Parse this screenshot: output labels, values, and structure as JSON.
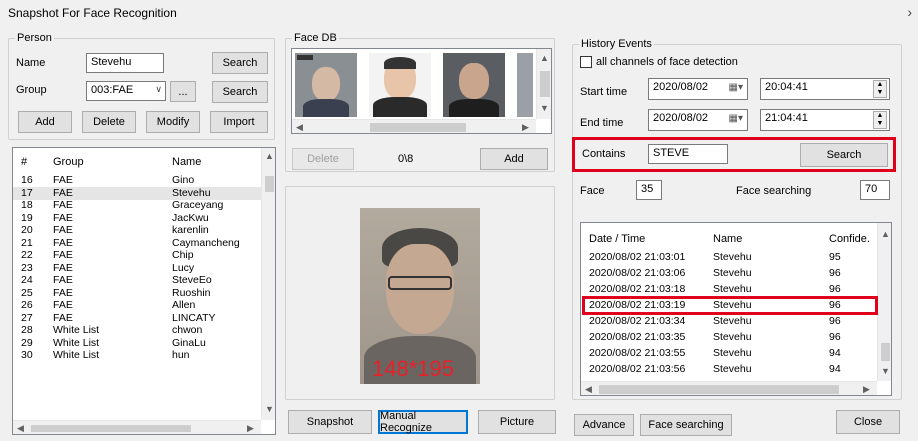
{
  "window": {
    "title": "Snapshot For Face Recognition",
    "close_glyph": "›"
  },
  "person": {
    "group_label": "Person",
    "name_label": "Name",
    "name_value": "Stevehu",
    "search_label": "Search",
    "group_field_label": "Group",
    "group_value": "003:FAE",
    "ellipsis_label": "...",
    "group_search_label": "Search",
    "add_label": "Add",
    "delete_label": "Delete",
    "modify_label": "Modify",
    "import_label": "Import",
    "list_headers": [
      "#",
      "Group",
      "Name"
    ],
    "rows": [
      {
        "num": "16",
        "group": "FAE",
        "name": "Gino"
      },
      {
        "num": "17",
        "group": "FAE",
        "name": "Stevehu"
      },
      {
        "num": "18",
        "group": "FAE",
        "name": "Graceyang"
      },
      {
        "num": "19",
        "group": "FAE",
        "name": "JacKwu"
      },
      {
        "num": "20",
        "group": "FAE",
        "name": "karenlin"
      },
      {
        "num": "21",
        "group": "FAE",
        "name": "Caymancheng"
      },
      {
        "num": "22",
        "group": "FAE",
        "name": "Chip"
      },
      {
        "num": "23",
        "group": "FAE",
        "name": "Lucy"
      },
      {
        "num": "24",
        "group": "FAE",
        "name": "SteveEo"
      },
      {
        "num": "25",
        "group": "FAE",
        "name": "Ruoshin"
      },
      {
        "num": "26",
        "group": "FAE",
        "name": "Allen"
      },
      {
        "num": "27",
        "group": "FAE",
        "name": "LINCATY"
      },
      {
        "num": "28",
        "group": "White List",
        "name": "chwon"
      },
      {
        "num": "29",
        "group": "White List",
        "name": "GinaLu"
      },
      {
        "num": "30",
        "group": "White List",
        "name": "hun"
      }
    ]
  },
  "facedb": {
    "group_label": "Face DB",
    "delete_label": "Delete",
    "counter": "0\\8",
    "add_label": "Add",
    "preview_size": "148*195"
  },
  "bottom": {
    "snapshot_label": "Snapshot",
    "manual_label": "Manual Recognize",
    "picture_label": "Picture",
    "advance_label": "Advance",
    "face_searching_label": "Face searching",
    "close_label": "Close"
  },
  "history": {
    "group_label": "History Events",
    "all_channels_label": "all channels of face detection",
    "start_label": "Start time",
    "start_date": "2020/08/02",
    "start_time": "20:04:41",
    "end_label": "End time",
    "end_date": "2020/08/02",
    "end_time": "21:04:41",
    "contains_label": "Contains",
    "contains_value": "STEVE",
    "search_label": "Search",
    "face_label": "Face",
    "face_value": "35",
    "face_searching_label": "Face searching",
    "face_searching_value": "70",
    "headers": [
      "Date / Time",
      "Name",
      "Confide."
    ],
    "events": [
      {
        "dt": "2020/08/02 21:03:01",
        "name": "Stevehu",
        "conf": "95"
      },
      {
        "dt": "2020/08/02 21:03:06",
        "name": "Stevehu",
        "conf": "96"
      },
      {
        "dt": "2020/08/02 21:03:18",
        "name": "Stevehu",
        "conf": "96"
      },
      {
        "dt": "2020/08/02 21:03:19",
        "name": "Stevehu",
        "conf": "96"
      },
      {
        "dt": "2020/08/02 21:03:34",
        "name": "Stevehu",
        "conf": "96"
      },
      {
        "dt": "2020/08/02 21:03:35",
        "name": "Stevehu",
        "conf": "96"
      },
      {
        "dt": "2020/08/02 21:03:55",
        "name": "Stevehu",
        "conf": "94"
      },
      {
        "dt": "2020/08/02 21:03:56",
        "name": "Stevehu",
        "conf": "94"
      }
    ]
  },
  "colors": {
    "highlight_red": "#e0001b",
    "focus_blue": "#0078d7"
  }
}
